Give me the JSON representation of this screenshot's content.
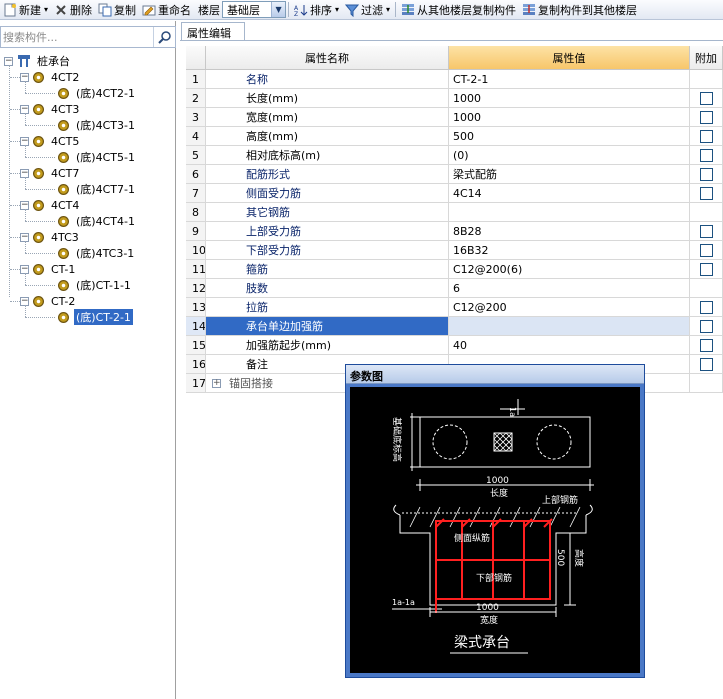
{
  "toolbar": {
    "new": "新建",
    "delete": "删除",
    "copy": "复制",
    "rename": "重命名",
    "floor_label": "楼层",
    "floor_value": "基础层",
    "sort": "排序",
    "filter": "过滤",
    "copy_from_floor": "从其他楼层复制构件",
    "copy_to_floor": "复制构件到其他楼层"
  },
  "search": {
    "placeholder": "搜索构件..."
  },
  "tree": {
    "root": "桩承台",
    "groups": [
      {
        "label": "4CT2",
        "child": "(底)4CT2-1"
      },
      {
        "label": "4CT3",
        "child": "(底)4CT3-1"
      },
      {
        "label": "4CT5",
        "child": "(底)4CT5-1"
      },
      {
        "label": "4CT7",
        "child": "(底)4CT7-1"
      },
      {
        "label": "4CT4",
        "child": "(底)4CT4-1"
      },
      {
        "label": "4TC3",
        "child": "(底)4TC3-1"
      },
      {
        "label": "CT-1",
        "child": "(底)CT-1-1"
      },
      {
        "label": "CT-2",
        "child": "(底)CT-2-1"
      }
    ]
  },
  "tab": {
    "label": "属性编辑"
  },
  "grid": {
    "headers": {
      "name": "属性名称",
      "value": "属性值",
      "extra": "附加"
    },
    "rows": [
      {
        "no": "1",
        "name": "名称",
        "value": "CT-2-1",
        "blue": true,
        "check": false
      },
      {
        "no": "2",
        "name": "长度(mm)",
        "value": "1000",
        "blue": false,
        "check": true
      },
      {
        "no": "3",
        "name": "宽度(mm)",
        "value": "1000",
        "blue": false,
        "check": true
      },
      {
        "no": "4",
        "name": "高度(mm)",
        "value": "500",
        "blue": false,
        "check": true
      },
      {
        "no": "5",
        "name": "相对底标高(m)",
        "value": "(0)",
        "blue": false,
        "check": true
      },
      {
        "no": "6",
        "name": "配筋形式",
        "value": "梁式配筋",
        "blue": true,
        "check": true
      },
      {
        "no": "7",
        "name": "侧面受力筋",
        "value": "4C14",
        "blue": true,
        "check": true
      },
      {
        "no": "8",
        "name": "其它钢筋",
        "value": "",
        "blue": true,
        "check": false
      },
      {
        "no": "9",
        "name": "上部受力筋",
        "value": "8B28",
        "blue": true,
        "check": true
      },
      {
        "no": "10",
        "name": "下部受力筋",
        "value": "16B32",
        "blue": true,
        "check": true
      },
      {
        "no": "11",
        "name": "箍筋",
        "value": "C12@200(6)",
        "blue": true,
        "check": true
      },
      {
        "no": "12",
        "name": "肢数",
        "value": "6",
        "blue": true,
        "check": false
      },
      {
        "no": "13",
        "name": "拉筋",
        "value": "C12@200",
        "blue": true,
        "check": true
      },
      {
        "no": "14",
        "name": "承台单边加强筋",
        "value": "",
        "blue": true,
        "check": true
      },
      {
        "no": "15",
        "name": "加强筋起步(mm)",
        "value": "40",
        "blue": false,
        "check": true
      },
      {
        "no": "16",
        "name": "备注",
        "value": "",
        "blue": false,
        "check": true
      },
      {
        "no": "17",
        "name": "锚固搭接",
        "value": "",
        "blue": false,
        "check": false
      }
    ]
  },
  "diagram": {
    "title": "参数图",
    "top_dim": "1a",
    "side_label": "基础底标高",
    "length_dim": "1000",
    "length_label": "长度",
    "top_bar_label": "上部钢筋",
    "side_bar_label": "侧面纵筋",
    "height_dim": "500",
    "height_label": "高度",
    "bottom_bar_label": "下部钢筋",
    "anchor_label": "1a-1a",
    "width_dim": "1000",
    "width_label": "宽度",
    "caption": "梁式承台"
  },
  "colors": {
    "selection": "#316ac5",
    "header_value": "#f7c66a",
    "rebar": "#ff2020"
  }
}
